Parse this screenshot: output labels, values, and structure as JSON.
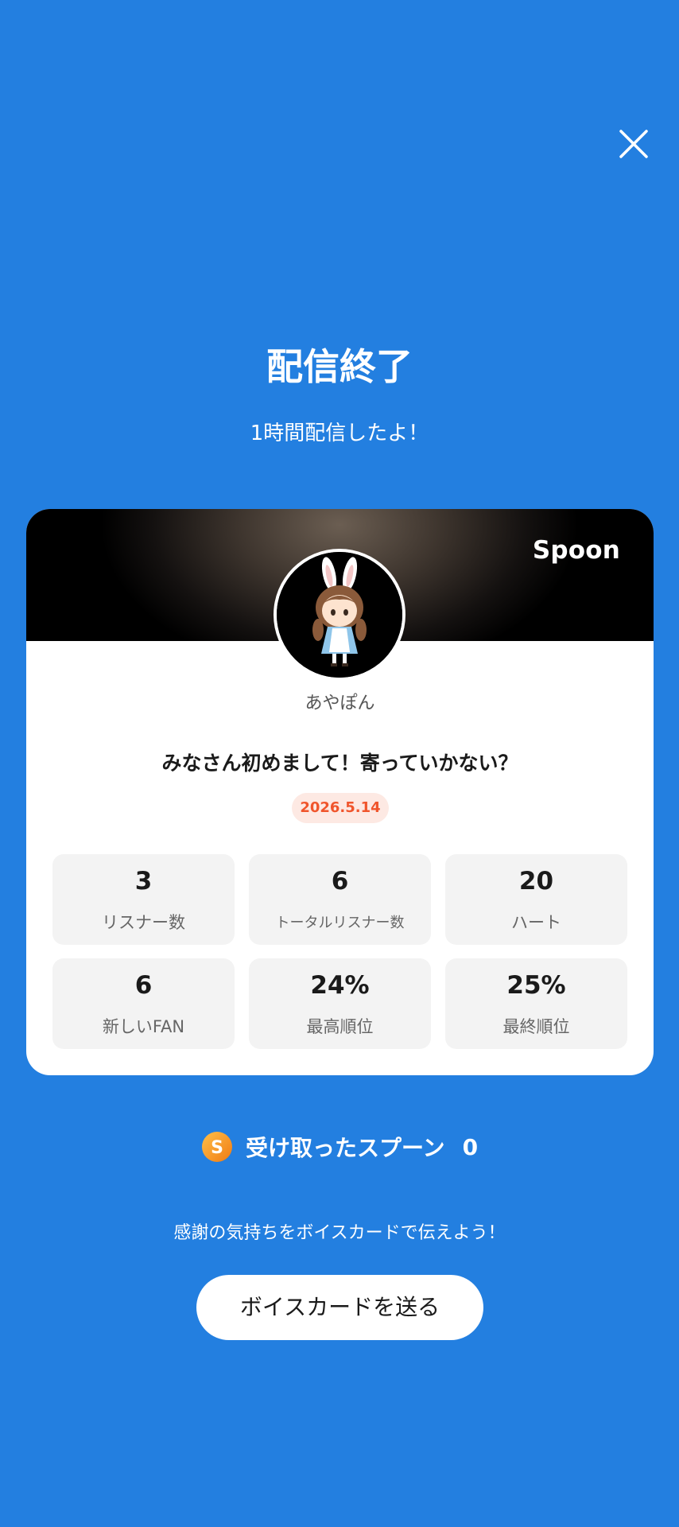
{
  "header": {
    "title": "配信終了",
    "subtitle": "1時間配信したよ！"
  },
  "card": {
    "brand": "Spoon",
    "username": "あやぽん",
    "stream_title": "みなさん初めまして！寄っていかない？",
    "date": "2026.5.14",
    "stats": [
      {
        "value": "3",
        "label": "リスナー数"
      },
      {
        "value": "6",
        "label": "トータルリスナー数"
      },
      {
        "value": "20",
        "label": "ハート"
      },
      {
        "value": "6",
        "label": "新しいFAN"
      },
      {
        "value": "24%",
        "label": "最高順位"
      },
      {
        "value": "25%",
        "label": "最終順位"
      }
    ]
  },
  "spoon": {
    "label": "受け取ったスプーン",
    "count": "0",
    "coin_letter": "S"
  },
  "footer": {
    "message": "感謝の気持ちをボイスカードで伝えよう！",
    "button_label": "ボイスカードを送る"
  },
  "colors": {
    "background": "#237fe0",
    "badge_text": "#f0552c",
    "badge_bg": "#fde9e3",
    "coin": "#f59a23"
  }
}
